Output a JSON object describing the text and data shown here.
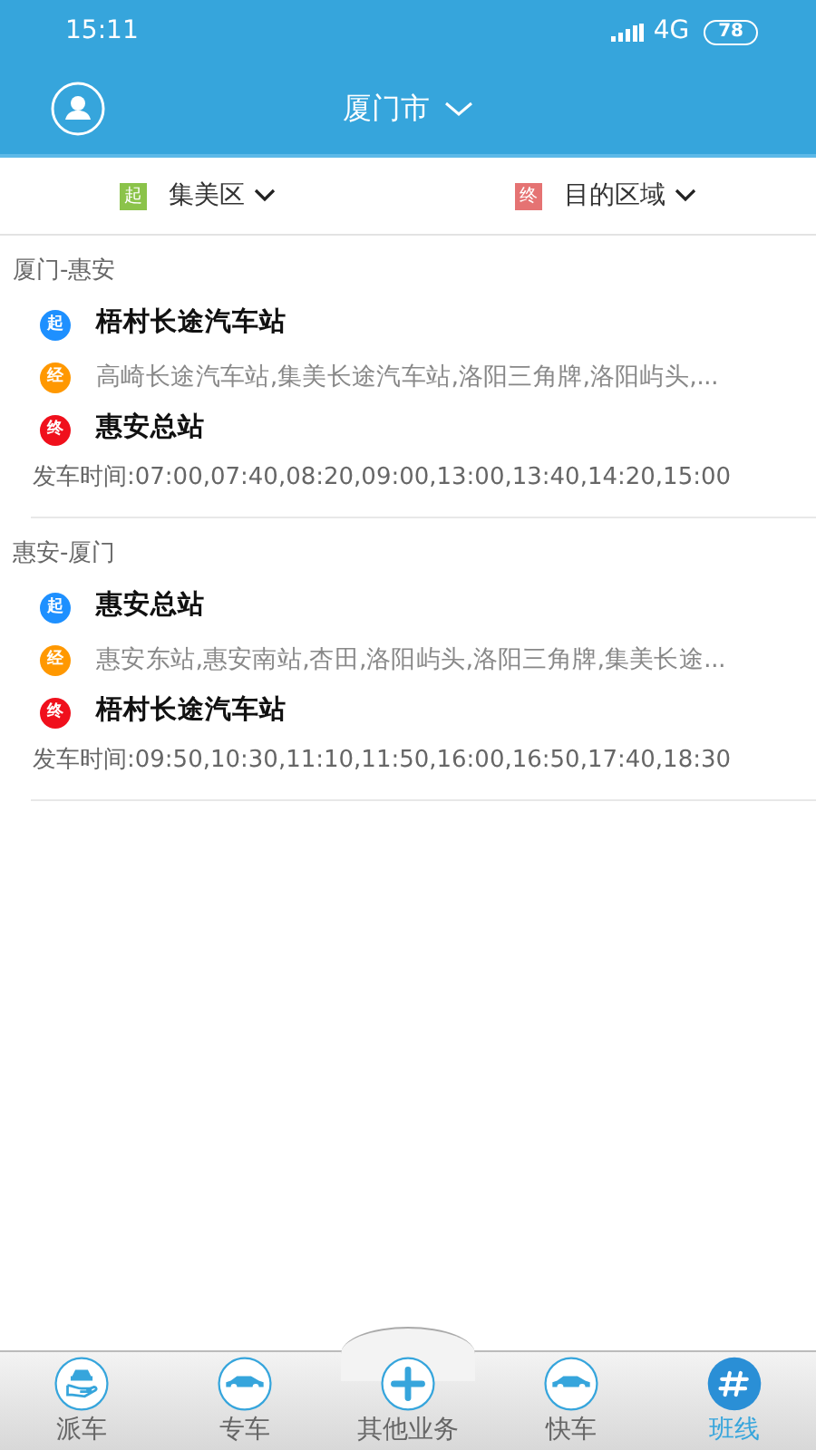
{
  "status_bar": {
    "time": "15:11",
    "network": "4G",
    "battery": "78"
  },
  "header": {
    "city": "厦门市"
  },
  "filters": [
    {
      "badge": "起",
      "kind": "start",
      "label": "集美区"
    },
    {
      "badge": "终",
      "kind": "end",
      "label": "目的区域"
    }
  ],
  "routes": [
    {
      "title": "厦门-惠安",
      "stops": [
        {
          "kind": "start",
          "badge": "起",
          "text": "梧村长途汽车站"
        },
        {
          "kind": "via",
          "badge": "经",
          "text": "高崎长途汽车站,集美长途汽车站,洛阳三角牌,洛阳屿头,..."
        },
        {
          "kind": "end",
          "badge": "终",
          "text": "惠安总站"
        }
      ],
      "times": "发车时间:07:00,07:40,08:20,09:00,13:00,13:40,14:20,15:00"
    },
    {
      "title": "惠安-厦门",
      "stops": [
        {
          "kind": "start",
          "badge": "起",
          "text": "惠安总站"
        },
        {
          "kind": "via",
          "badge": "经",
          "text": "惠安东站,惠安南站,杏田,洛阳屿头,洛阳三角牌,集美长途..."
        },
        {
          "kind": "end",
          "badge": "终",
          "text": "梧村长途汽车站"
        }
      ],
      "times": "发车时间:09:50,10:30,11:10,11:50,16:00,16:50,17:40,18:30"
    }
  ],
  "tab_bar": [
    {
      "label": "派车",
      "kind": "dispatch",
      "selected": false
    },
    {
      "label": "专车",
      "kind": "car",
      "selected": false
    },
    {
      "label": "其他业务",
      "kind": "plus",
      "selected": false
    },
    {
      "label": "快车",
      "kind": "car",
      "selected": false
    },
    {
      "label": "班线",
      "kind": "hash",
      "selected": true
    }
  ]
}
